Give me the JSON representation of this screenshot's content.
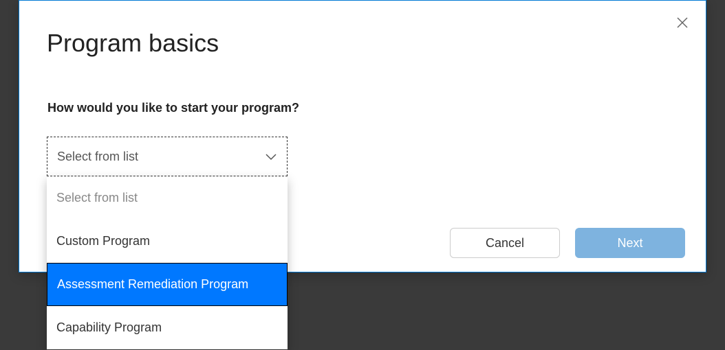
{
  "modal": {
    "title": "Program basics",
    "question": "How would you like to start your program?",
    "select": {
      "value": "Select from list",
      "options": [
        {
          "label": "Select from list",
          "placeholder": true,
          "selected": false
        },
        {
          "label": "Custom Program",
          "placeholder": false,
          "selected": false
        },
        {
          "label": "Assessment Remediation Program",
          "placeholder": false,
          "selected": true
        },
        {
          "label": "Capability Program",
          "placeholder": false,
          "selected": false
        }
      ]
    },
    "buttons": {
      "cancel": "Cancel",
      "next": "Next"
    }
  }
}
